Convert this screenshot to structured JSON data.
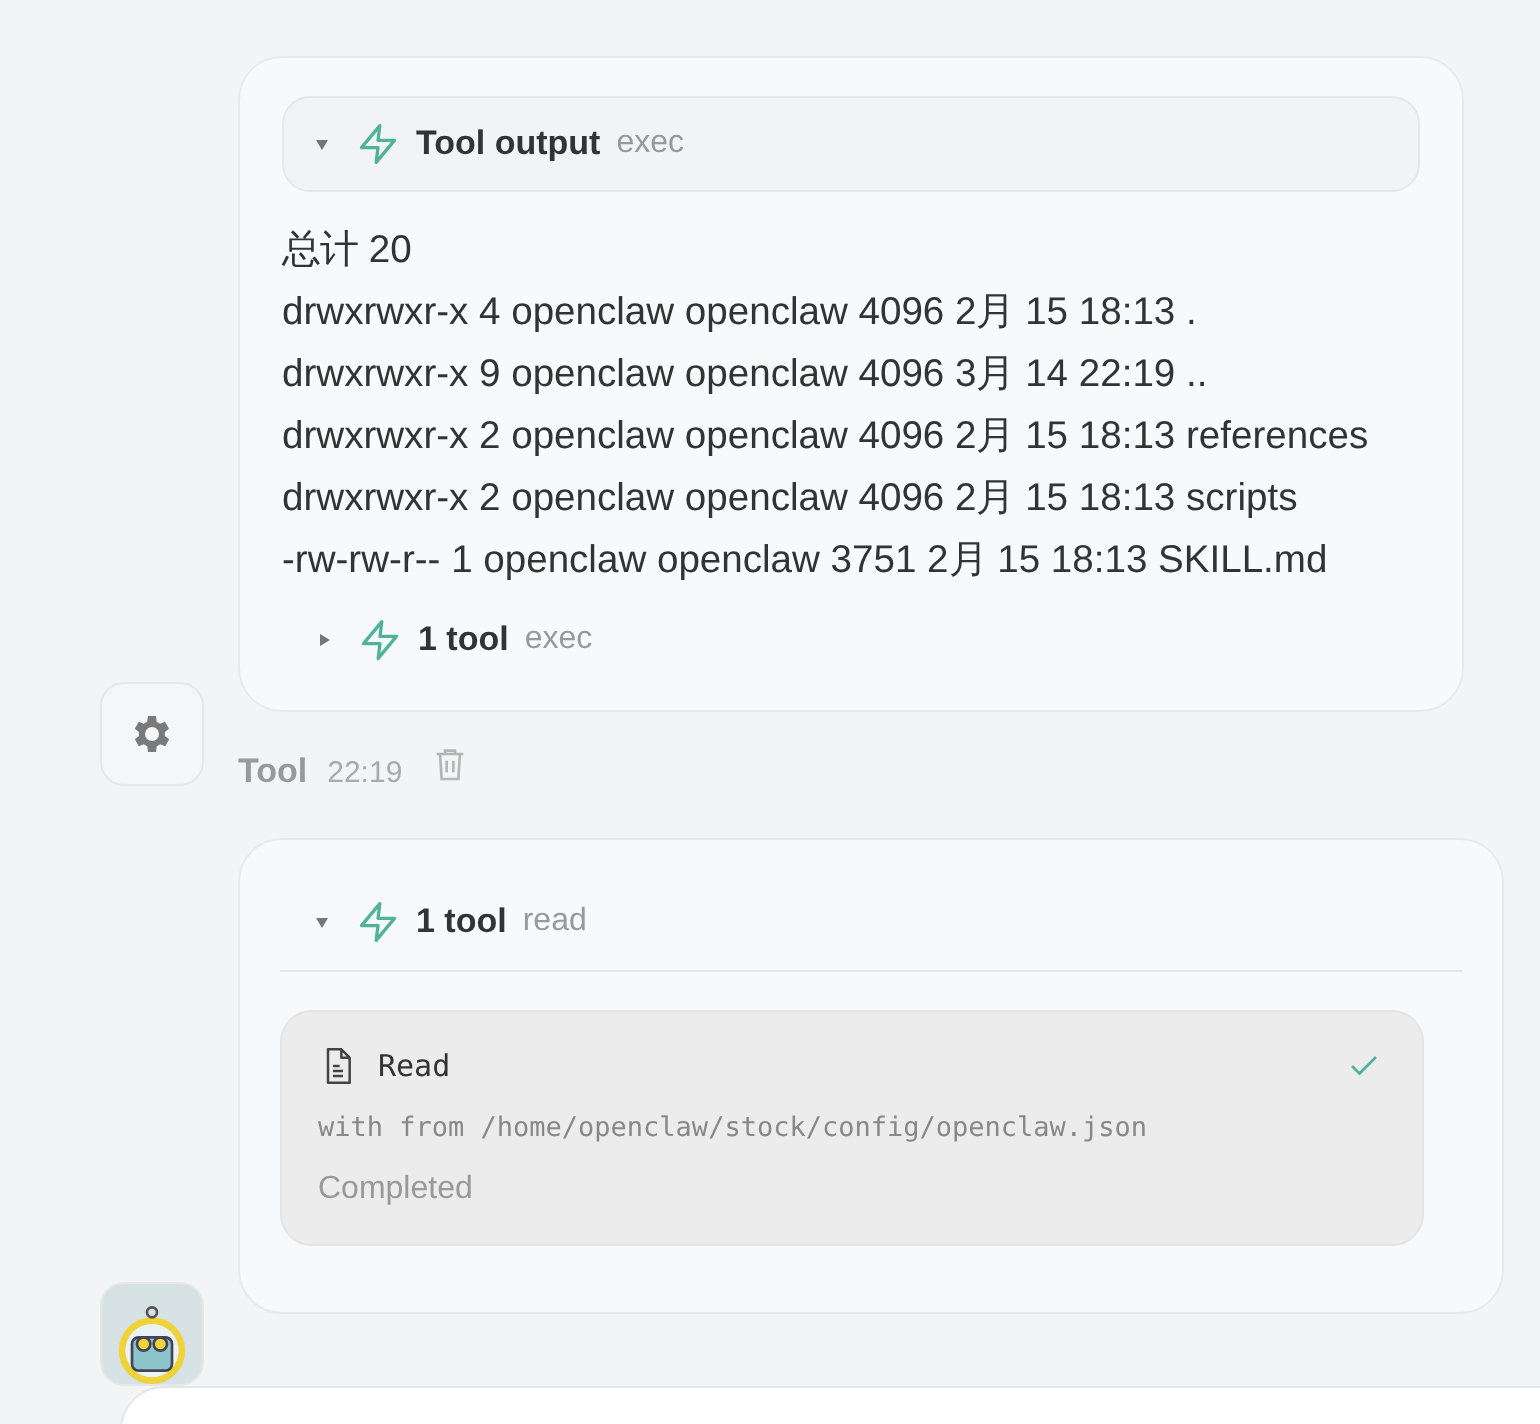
{
  "tool_output_card": {
    "title": "Tool output",
    "tool": "exec",
    "expanded": true,
    "lines": [
      "总计 20",
      "drwxrwxr-x 4 openclaw openclaw 4096 2月 15 18:13 .",
      "drwxrwxr-x 9 openclaw openclaw 4096 3月 14 22:19 ..",
      "drwxrwxr-x 2 openclaw openclaw 4096 2月 15 18:13 references",
      "drwxrwxr-x 2 openclaw openclaw 4096 2月 15 18:13 scripts",
      "-rw-rw-r-- 1 openclaw openclaw 3751 2月 15 18:13 SKILL.md"
    ],
    "summary": {
      "label": "1 tool",
      "tool": "exec",
      "expanded": false
    }
  },
  "tool_message": {
    "sender": "Tool",
    "time": "22:19"
  },
  "tool_card": {
    "label": "1 tool",
    "tool": "read",
    "expanded": true,
    "call": {
      "name": "Read",
      "detail": "with from /home/openclaw/stock/config/openclaw.json",
      "status": "Completed",
      "done": true
    }
  }
}
